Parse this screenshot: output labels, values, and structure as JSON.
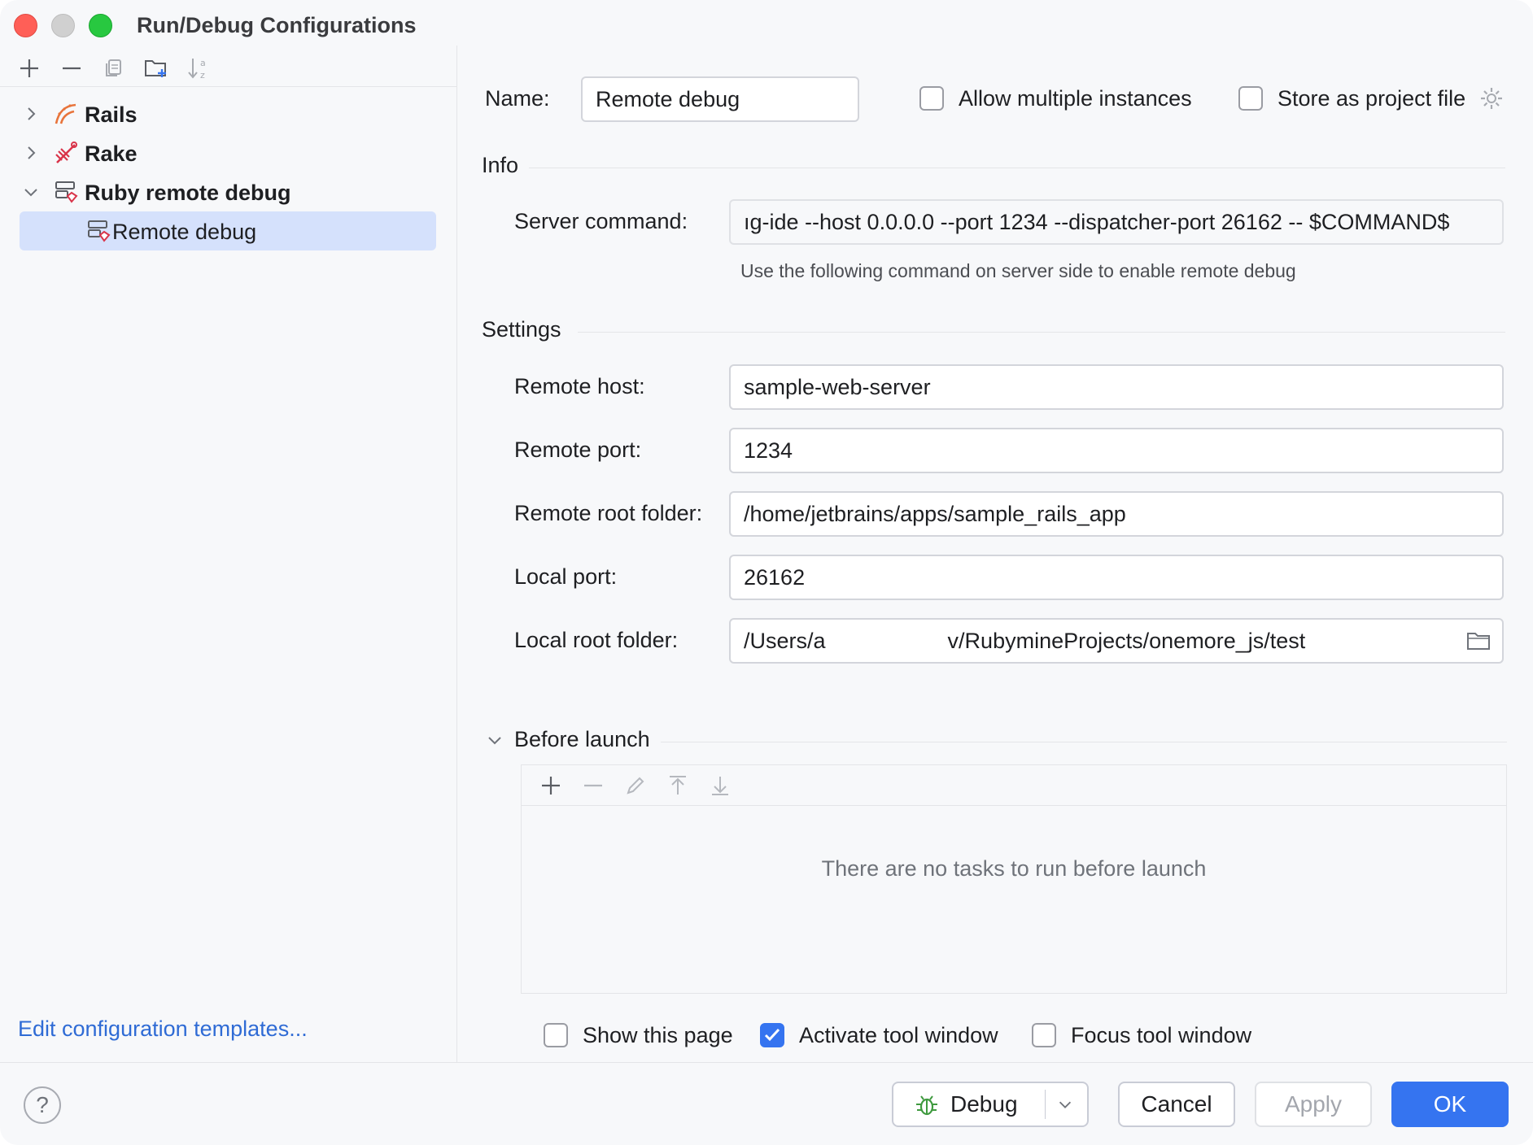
{
  "window": {
    "title": "Run/Debug Configurations"
  },
  "left_panel": {
    "toolbar": {
      "add": "plus-icon",
      "remove": "minus-icon",
      "copy": "copy-icon",
      "new_folder": "new-folder-icon",
      "sort": "sort-alpha-icon"
    },
    "tree": [
      {
        "label": "Rails",
        "expanded": false,
        "icon": "rails-icon"
      },
      {
        "label": "Rake",
        "expanded": false,
        "icon": "rake-icon"
      },
      {
        "label": "Ruby remote debug",
        "expanded": true,
        "icon": "ruby-remote-debug-icon"
      },
      {
        "label": "Remote debug",
        "selected": true,
        "icon": "remote-debug-config-icon"
      }
    ],
    "templates_link": "Edit configuration templates..."
  },
  "form": {
    "name_label": "Name:",
    "name_value": "Remote debug",
    "allow_multiple_label": "Allow multiple instances",
    "allow_multiple_checked": false,
    "store_as_project_label": "Store as project file",
    "store_as_project_checked": false,
    "info_title": "Info",
    "server_command_label": "Server command:",
    "server_command_value": "ıg-ide --host 0.0.0.0 --port 1234 --dispatcher-port 26162 -- $COMMAND$",
    "server_command_hint": "Use the following command on server side to enable remote debug",
    "settings_title": "Settings",
    "remote_host_label": "Remote host:",
    "remote_host_value": "sample-web-server",
    "remote_port_label": "Remote port:",
    "remote_port_value": "1234",
    "remote_root_label": "Remote root folder:",
    "remote_root_value": "/home/jetbrains/apps/sample_rails_app",
    "local_port_label": "Local port:",
    "local_port_value": "26162",
    "local_root_label": "Local root folder:",
    "local_root_value": "/Users/a                    v/RubymineProjects/onemore_js/test"
  },
  "before_launch": {
    "title": "Before launch",
    "expanded": true,
    "empty_text": "There are no tasks to run before launch",
    "show_page_label": "Show this page",
    "show_page_checked": false,
    "activate_tool_label": "Activate tool window",
    "activate_tool_checked": true,
    "focus_tool_label": "Focus tool window",
    "focus_tool_checked": false
  },
  "footer": {
    "help": "?",
    "debug_label": "Debug",
    "cancel_label": "Cancel",
    "apply_label": "Apply",
    "ok_label": "OK"
  },
  "colors": {
    "accent": "#3574f0",
    "selection": "#d5e1fc",
    "link": "#2f6bd5",
    "rails_icon": "#e8743b",
    "rake_icon": "#d9344a"
  }
}
